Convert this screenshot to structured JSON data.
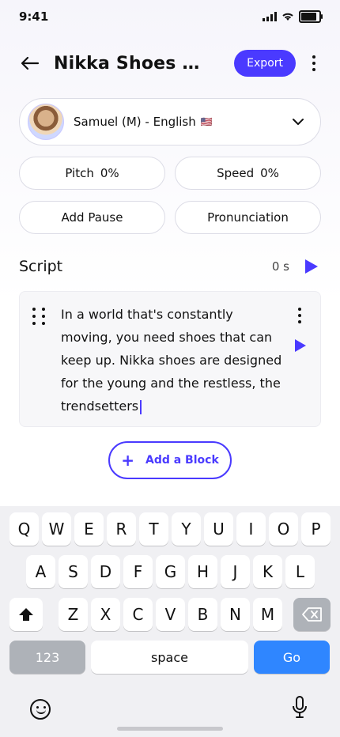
{
  "status_bar": {
    "time": "9:41"
  },
  "header": {
    "title": "Nikka Shoes Pro...",
    "export_label": "Export"
  },
  "voice": {
    "label": "Samuel (M) - English",
    "flag": "🇺🇸"
  },
  "controls": {
    "pitch_label": "Pitch",
    "pitch_value": "0%",
    "speed_label": "Speed",
    "speed_value": "0%",
    "add_pause_label": "Add Pause",
    "pronunciation_label": "Pronunciation"
  },
  "script": {
    "title": "Script",
    "duration": "0 s",
    "blocks": [
      {
        "text": "In a world that's constantly moving, you need shoes that can keep up. Nikka shoes are designed for the young and the restless, the trendsetters"
      }
    ],
    "add_block_label": "Add a Block"
  },
  "keyboard": {
    "row1": [
      "Q",
      "W",
      "E",
      "R",
      "T",
      "Y",
      "U",
      "I",
      "O",
      "P"
    ],
    "row2": [
      "A",
      "S",
      "D",
      "F",
      "G",
      "H",
      "J",
      "K",
      "L"
    ],
    "row3": [
      "Z",
      "X",
      "C",
      "V",
      "B",
      "N",
      "M"
    ],
    "numbers_label": "123",
    "space_label": "space",
    "go_label": "Go"
  },
  "colors": {
    "accent": "#4a3aff",
    "go_key": "#2f86ff"
  },
  "icons": [
    "back-arrow-icon",
    "kebab-menu-icon",
    "chevron-down-icon",
    "play-icon",
    "drag-handle-icon",
    "plus-icon",
    "shift-icon",
    "backspace-icon",
    "emoji-icon",
    "microphone-icon"
  ]
}
